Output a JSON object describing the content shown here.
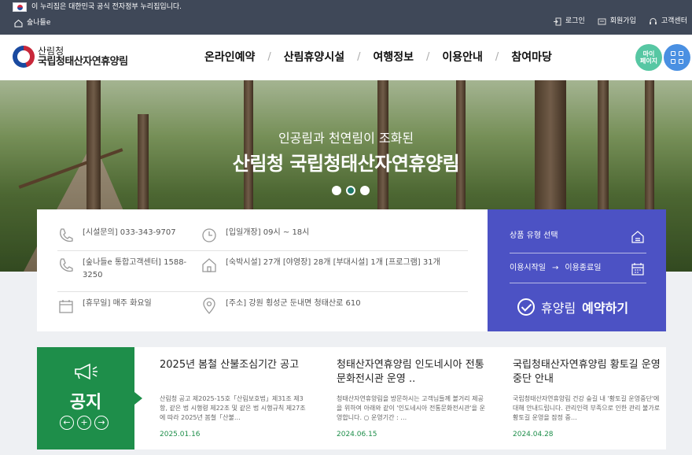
{
  "govbar": {
    "notice": "이 누리집은 대한민국 공식 전자정부 누리집입니다.",
    "site": "숲나들e",
    "login": "로그인",
    "signup": "회원가입",
    "support": "고객센터"
  },
  "header": {
    "logo_line1": "산림청",
    "logo_line2": "국립청태산자연휴양림",
    "nav": [
      "온라인예약",
      "산림휴양시설",
      "여행정보",
      "이용안내",
      "참여마당"
    ],
    "mypage": "마이\n페이지"
  },
  "hero": {
    "subtitle": "인공림과 천연림이 조화된",
    "title": "산림청 국립청태산자연휴양림",
    "slides": 3,
    "active_slide": 2
  },
  "info": {
    "phone": "[시설문의] 033-343-9707",
    "hours": "[입일개장] 09시 ~ 18시",
    "callcenter": "[숲나들e 통합고객센터] 1588-3250",
    "facilities": "[숙박시설] 27개 [야영장] 28개 [부대시설] 1개 [프로그램] 31개",
    "closed": "[휴무일] 매주 화요일",
    "address": "[주소] 강원 횡성군 둔내면 청태산로 610"
  },
  "reservation": {
    "product_type": "상품 유형 선택",
    "start_date": "이용시작일",
    "arrow": "→",
    "end_date": "이용종료일",
    "button_normal": "휴양림",
    "button_bold": "예약하기"
  },
  "notice": {
    "label": "공지",
    "prev": "←",
    "add": "+",
    "next": "→",
    "articles": [
      {
        "title": "2025년 봄철 산불조심기간 공고",
        "desc": "산림청 공고 제2025-15호「산림보호법」제31조 제3항, 같은 법 시행령 제22조 및 같은 법 시행규칙 제27조에 따라 2025년 봄철「산불…",
        "date": "2025.01.16"
      },
      {
        "title": "청태산자연휴양림 인도네시아 전통문화전시관 운영 ..",
        "desc": "청태산자연휴양림을 방문하시는 고객님들께 볼거리 제공을 위하여 아래와 같이 '인도네시아 전통문화전시관'을 운영합니다. ○ 운영기간 : …",
        "date": "2024.06.15"
      },
      {
        "title": "국립청태산자연휴양림 황토길 운영중단 안내",
        "desc": "국립청태산자연휴양림 건강 숲길 내 '황토길 운영중단'에 대해 안내드립니다. 관리인력 부족으로 인한 관리 불가로 황토길 운영을 잠정 중…",
        "date": "2024.04.28"
      }
    ]
  }
}
